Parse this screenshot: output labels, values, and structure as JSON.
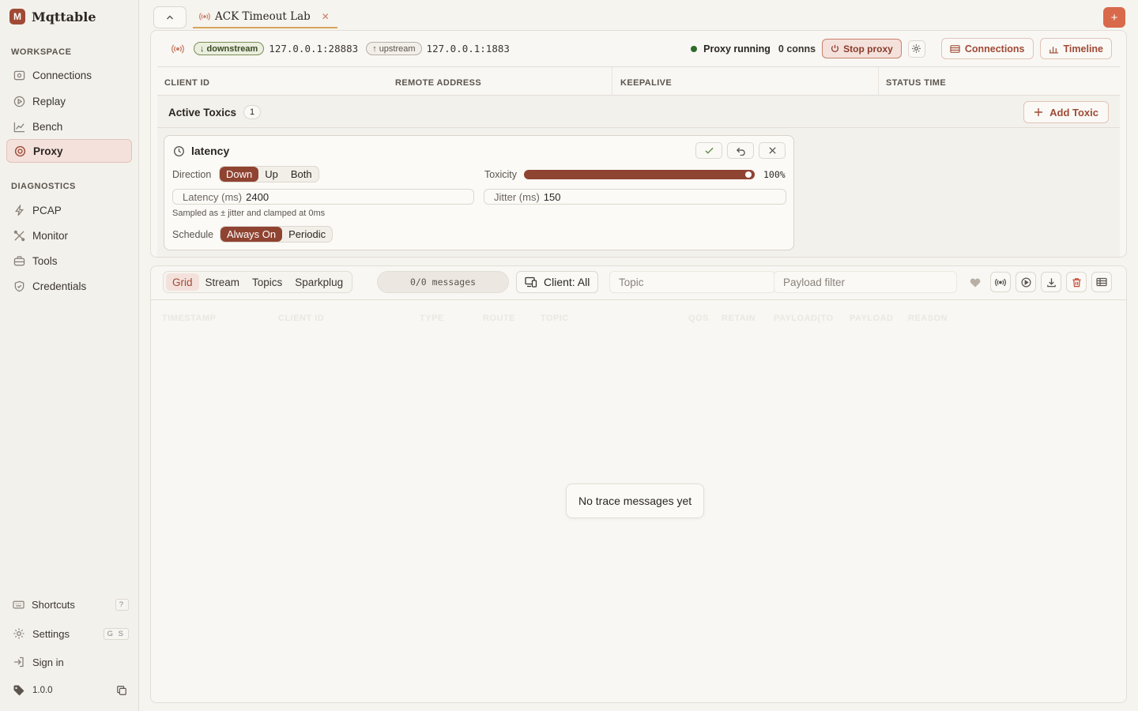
{
  "app": {
    "name": "Mqttable"
  },
  "sidebar": {
    "workspace_label": "WORKSPACE",
    "workspace_items": [
      {
        "label": "Connections",
        "icon": "connections-icon"
      },
      {
        "label": "Replay",
        "icon": "replay-icon"
      },
      {
        "label": "Bench",
        "icon": "bench-icon"
      },
      {
        "label": "Proxy",
        "icon": "proxy-icon",
        "active": true
      }
    ],
    "diagnostics_label": "DIAGNOSTICS",
    "diagnostics_items": [
      {
        "label": "PCAP",
        "icon": "pcap-icon"
      },
      {
        "label": "Monitor",
        "icon": "monitor-icon"
      },
      {
        "label": "Tools",
        "icon": "tools-icon"
      },
      {
        "label": "Credentials",
        "icon": "credentials-icon"
      }
    ],
    "bottom": {
      "shortcuts": {
        "label": "Shortcuts",
        "key": "?"
      },
      "settings": {
        "label": "Settings",
        "key": "G S"
      },
      "sign_in": {
        "label": "Sign in"
      },
      "version": {
        "label": "1.0.0"
      }
    }
  },
  "tabs": [
    {
      "title": "ACK Timeout Lab",
      "active": true
    }
  ],
  "proxy": {
    "downstream_label": "downstream",
    "downstream_addr": "127.0.0.1:28883",
    "upstream_label": "upstream",
    "upstream_addr": "127.0.0.1:1883",
    "status": "Proxy running",
    "conns": "0 conns",
    "stop_label": "Stop proxy",
    "connections_label": "Connections",
    "timeline_label": "Timeline",
    "columns": [
      "CLIENT ID",
      "REMOTE ADDRESS",
      "KEEPALIVE",
      "STATUS TIME"
    ],
    "toxics": {
      "title": "Active Toxics",
      "count": "1",
      "add_label": "Add Toxic",
      "items": [
        {
          "name": "latency",
          "direction_label": "Direction",
          "direction_options": [
            "Down",
            "Up",
            "Both"
          ],
          "direction_selected": "Down",
          "toxicity_label": "Toxicity",
          "toxicity": 1.0,
          "toxicity_text": "100%",
          "latency_label": "Latency (ms)",
          "latency_value": "2400",
          "jitter_label": "Jitter (ms)",
          "jitter_value": "150",
          "hint": "Sampled as ± jitter and clamped at 0ms",
          "schedule_label": "Schedule",
          "schedule_options": [
            "Always On",
            "Periodic"
          ],
          "schedule_selected": "Always On"
        }
      ]
    }
  },
  "messages": {
    "views": [
      "Grid",
      "Stream",
      "Topics",
      "Sparkplug"
    ],
    "active_view": "Grid",
    "count": "0/0 messages",
    "client_filter": "Client: All",
    "topic_placeholder": "Topic",
    "payload_placeholder": "Payload filter",
    "columns": [
      "TIMESTAMP",
      "CLIENT ID",
      "TYPE",
      "ROUTE",
      "TOPIC",
      "QOS",
      "RETAIN",
      "PAYLOAD(TO",
      "PAYLOAD",
      "REASON"
    ],
    "empty_text": "No trace messages yet"
  },
  "colors": {
    "accent": "#a04a35",
    "segment_on": "#8f4331",
    "add_tab": "#d9694b",
    "running_dot": "#2f6b2d"
  }
}
